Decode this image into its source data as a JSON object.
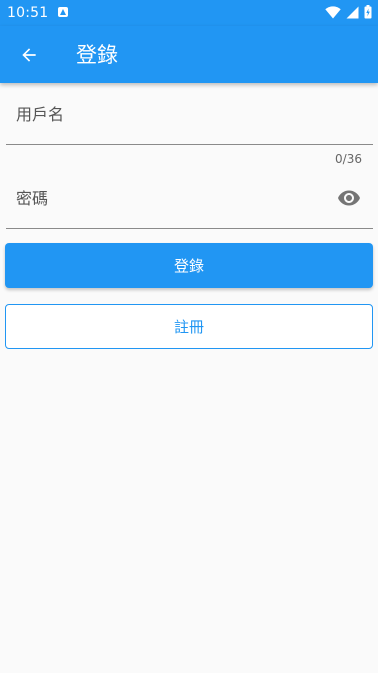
{
  "status_bar": {
    "time": "10:51",
    "icons": [
      "notification-a-icon",
      "wifi-icon",
      "signal-icon",
      "battery-icon"
    ]
  },
  "app_bar": {
    "title": "登錄",
    "back_icon": "arrow-left-icon",
    "color": "#2196f3"
  },
  "form": {
    "username": {
      "placeholder": "用戶名",
      "value": "",
      "counter": "0/36"
    },
    "password": {
      "placeholder": "密碼",
      "value": "",
      "toggle_icon": "eye-icon"
    }
  },
  "buttons": {
    "login_label": "登錄",
    "register_label": "註冊"
  },
  "colors": {
    "primary": "#2196f3",
    "background": "#fafafa"
  }
}
